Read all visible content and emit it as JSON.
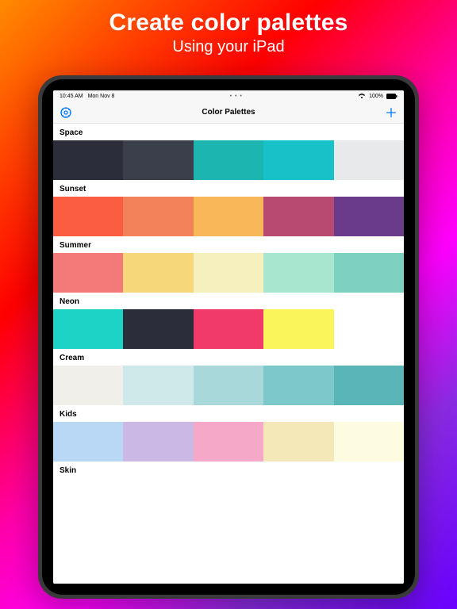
{
  "hero": {
    "title": "Create color palettes",
    "subtitle": "Using your iPad"
  },
  "statusBar": {
    "time": "10:45 AM",
    "date": "Mon Nov 8",
    "batteryPercent": "100%"
  },
  "nav": {
    "title": "Color Palettes"
  },
  "palettes": [
    {
      "name": "Space",
      "colors": [
        "#2b2d3a",
        "#3b3f4c",
        "#1db5b0",
        "#16c1c8",
        "#e8e9eb"
      ]
    },
    {
      "name": "Sunset",
      "colors": [
        "#fa5d3f",
        "#f3825a",
        "#f8b85a",
        "#b84a72",
        "#6a3b8a"
      ]
    },
    {
      "name": "Summer",
      "colors": [
        "#f47a7a",
        "#f6d77a",
        "#f5f0bd",
        "#a8e6d0",
        "#7cd1c0"
      ]
    },
    {
      "name": "Neon",
      "colors": [
        "#1dd3c5",
        "#2b2d3a",
        "#f23a6a",
        "#f9f55a",
        "#ffffff"
      ]
    },
    {
      "name": "Cream",
      "colors": [
        "#f0efe9",
        "#cfe9ea",
        "#a8d8da",
        "#7cc8cb",
        "#5ab5b8"
      ]
    },
    {
      "name": "Kids",
      "colors": [
        "#b8d8f5",
        "#cbb8e5",
        "#f5a8c8",
        "#f5e8b8",
        "#fdfbe0"
      ]
    },
    {
      "name": "Skin",
      "colors": []
    }
  ]
}
